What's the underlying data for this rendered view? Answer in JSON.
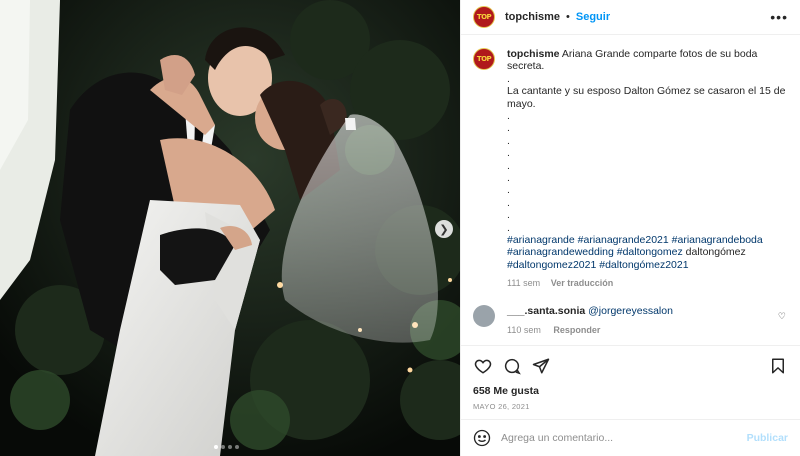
{
  "post": {
    "username": "topchisme",
    "follow_label": "Seguir",
    "header_separator": "•",
    "more_label": "•••",
    "avatar_text": "TOP",
    "caption": {
      "username": "topchisme",
      "title": "Ariana Grande comparte fotos de su boda secreta.",
      "dot": ".",
      "body": "La cantante y su esposo Dalton Gómez se casaron el 15 de mayo.",
      "hashtags": "#arianagrande #arianagrande2021 #arianagrandeboda #arianagrandewedding #daltongomez",
      "plain_tag": "daltongómez",
      "hashtags2": "#daltongomez2021 #daltongómez2021",
      "age": "111 sem",
      "translate": "Ver traducción"
    },
    "comment": {
      "username": "___.santa.sonia",
      "mention": "@jorgereyessalon",
      "age": "110 sem",
      "reply_label": "Responder"
    },
    "likes": "658 Me gusta",
    "date": "MAYO 26, 2021",
    "add_comment_placeholder": "Agrega un comentario...",
    "publish_label": "Publicar"
  },
  "carousel": {
    "next_icon": "chevron-right-icon",
    "slides": 4,
    "active_slide": 1
  },
  "icons": [
    "more-icon",
    "heart-icon",
    "comment-icon",
    "share-icon",
    "bookmark-icon",
    "emoji-icon",
    "chevron-right-icon"
  ],
  "colors": {
    "accent": "#0095f6",
    "hashtag": "#00376b",
    "muted": "#8e8e8e",
    "publish_disabled": "#b2dffc"
  }
}
